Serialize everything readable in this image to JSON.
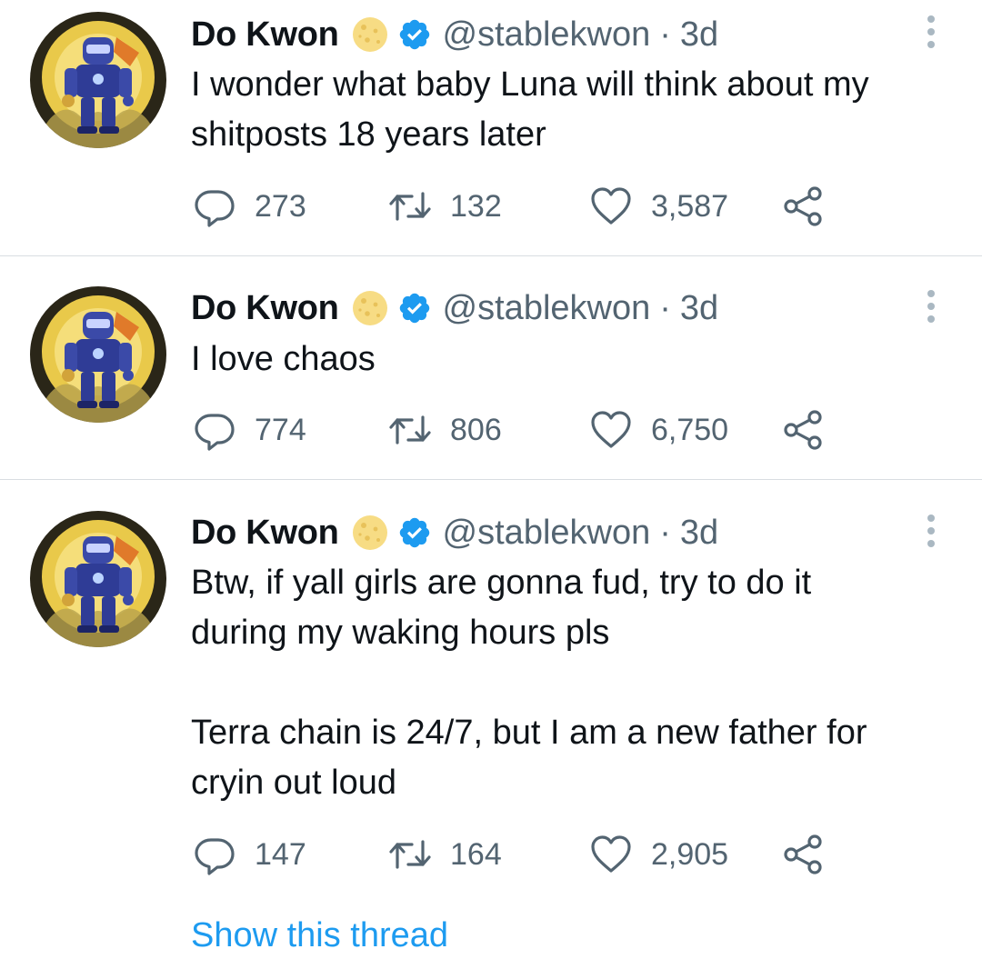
{
  "colors": {
    "accent": "#1d9bf0",
    "secondary_text": "#536471",
    "divider": "#d9dde1",
    "verified_badge": "#1d9bf0"
  },
  "tweets": [
    {
      "name": "Do Kwon",
      "name_emoji": "moon-emoji",
      "verified": true,
      "handle": "@stablekwon",
      "separator": "·",
      "time": "3d",
      "text": "I wonder what baby Luna will think about my shitposts 18 years later",
      "replies": "273",
      "retweets": "132",
      "likes": "3,587"
    },
    {
      "name": "Do Kwon",
      "name_emoji": "moon-emoji",
      "verified": true,
      "handle": "@stablekwon",
      "separator": "·",
      "time": "3d",
      "text": "I love chaos",
      "replies": "774",
      "retweets": "806",
      "likes": "6,750"
    },
    {
      "name": "Do Kwon",
      "name_emoji": "moon-emoji",
      "verified": true,
      "handle": "@stablekwon",
      "separator": "·",
      "time": "3d",
      "text": "Btw, if yall girls are gonna fud, try to do it\nduring my waking hours pls\n\nTerra chain is 24/7, but I am a new father for\ncryin out loud",
      "replies": "147",
      "retweets": "164",
      "likes": "2,905"
    }
  ],
  "icons": {
    "reply": "reply-icon",
    "retweet": "retweet-icon",
    "like": "heart-icon",
    "share": "share-icon",
    "more": "more-icon",
    "verified": "verified-badge-icon"
  },
  "show_thread": "Show this thread"
}
